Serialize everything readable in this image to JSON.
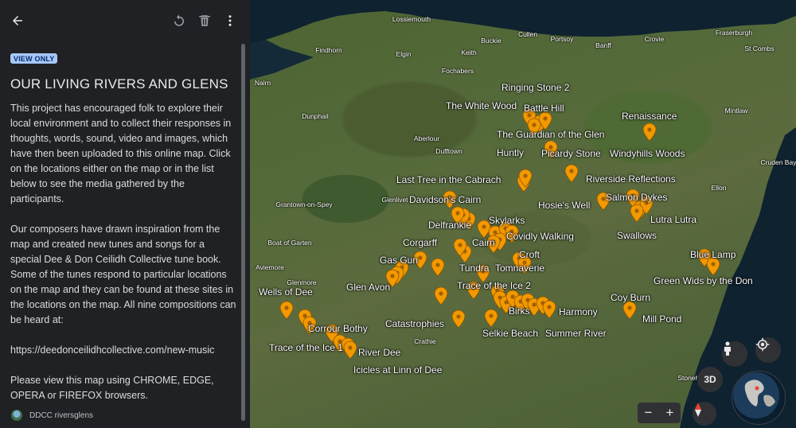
{
  "toolbar": {
    "back_icon": "arrow-back-icon",
    "reset_icon": "reset-icon",
    "delete_icon": "trash-icon",
    "menu_icon": "more-vert-icon"
  },
  "panel": {
    "badge": "VIEW ONLY",
    "title": "OUR LIVING RIVERS AND GLENS",
    "paragraphs": [
      "This project has encouraged folk to explore their local environment and to collect their responses in thoughts, words, sound, video and images, which have then been uploaded to this online map. Click on the locations either on the map or in the list below to see the media gathered by the participants.",
      "Our composers have drawn inspiration from the map and created new  tunes and songs for a special Dee & Don Ceilidh Collective tune book. Some of the tunes respond to particular locations on the map and they can be found at these sites in the locations on the map. All nine compositions can be heard at:",
      "https://deedonceilidhcollective.com/new-music",
      "Please view this map using CHROME, EDGE, OPERA or FIREFOX browsers."
    ],
    "footer_name": "DDCC riversglens"
  },
  "map": {
    "pin_color": "#f29900",
    "towns": [
      "Lossiemouth",
      "Buckie",
      "Cullen",
      "Portsoy",
      "Banff",
      "Crovie",
      "Fraserburgh",
      "St Combs",
      "Findhorn",
      "Elgin",
      "Keith",
      "Nairn",
      "Fochabers",
      "Dunphail",
      "Mintlaw",
      "Aberlour",
      "Dufftown",
      "Cruden Bay",
      "Glenlivet",
      "Grantown-on-Spey",
      "Ellon",
      "Boat of Garten",
      "Aviemore",
      "Glenmore",
      "Crathie",
      "Stonehaven"
    ],
    "places": [
      "Ringing Stone 2",
      "The White Wood",
      "Battle Hill",
      "Renaissance",
      "The Guardian of the Glen",
      "Huntly",
      "Picardy Stone",
      "Windyhills Woods",
      "Last Tree in the Cabrach",
      "Riverside Reflections",
      "Davidson's Cairn",
      "Hosie's Well",
      "Salmon Dykes",
      "Delfrankie",
      "Skylarks",
      "Lutra Lutra",
      "Swallows",
      "Corgarff",
      "Cairn",
      "Covidly Walking",
      "Croft",
      "Gas Gun",
      "Tundra",
      "Tomnaverie",
      "Blue Lamp",
      "Glen Avon",
      "Trace of the Ice 2",
      "Green Wids by the Don",
      "Wells of Dee",
      "Coy Burn",
      "Birks",
      "Harmony",
      "Mill Pond",
      "Catastrophies",
      "Corrour Bothy",
      "Selkie Beach",
      "Summer River",
      "Trace of the Ice 1",
      "River Dee",
      "Icicles at Linn of Dee"
    ],
    "controls": {
      "pegman_icon": "pegman-icon",
      "location_icon": "my-location-icon",
      "three_d_label": "3D",
      "zoom_out": "−",
      "zoom_in": "+",
      "compass_icon": "compass-icon",
      "globe_icon": "globe-icon"
    }
  }
}
